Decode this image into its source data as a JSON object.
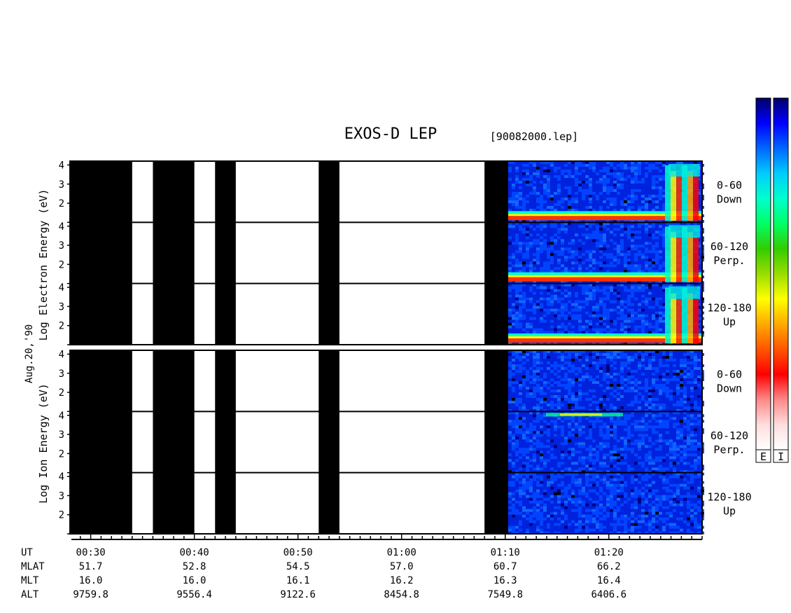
{
  "header": {
    "title": "EXOS-D LEP",
    "file_label": "[90082000.lep]"
  },
  "date_label": "Aug.20,'90",
  "panels": {
    "electron": {
      "ylabel": "Log Electron Energy (eV)",
      "yticks": [
        "4",
        "3",
        "2"
      ],
      "channels": [
        {
          "label_line1": "0-60",
          "label_line2": "Down"
        },
        {
          "label_line1": "60-120",
          "label_line2": "Perp."
        },
        {
          "label_line1": "120-180",
          "label_line2": "Up"
        }
      ]
    },
    "ion": {
      "ylabel": "Log Ion Energy (eV)",
      "yticks": [
        "4",
        "3",
        "2"
      ],
      "channels": [
        {
          "label_line1": "0-60",
          "label_line2": "Down"
        },
        {
          "label_line1": "60-120",
          "label_line2": "Perp."
        },
        {
          "label_line1": "120-180",
          "label_line2": "Up"
        }
      ]
    }
  },
  "colorbars": {
    "labels": [
      "E",
      "I"
    ],
    "colors_top_to_bottom": [
      "#000066",
      "#0000ff",
      "#0066ff",
      "#00ccff",
      "#00ffcc",
      "#00ff66",
      "#33cc00",
      "#99dd00",
      "#ffff00",
      "#ffaa00",
      "#ff5500",
      "#ff0000",
      "#ff8888",
      "#ffdddd",
      "#ffffff"
    ]
  },
  "chart_data": {
    "type": "heatmap",
    "title": "EXOS-D LEP",
    "xlabel": "UT",
    "ylabel": "Log Energy (eV)",
    "x_ticks": [
      "00:30",
      "00:40",
      "00:50",
      "01:00",
      "01:10",
      "01:20"
    ],
    "ylim": [
      1,
      4.2
    ],
    "data_gaps_ut": [
      [
        "00:28",
        "00:34"
      ],
      [
        "00:36",
        "00:40"
      ],
      [
        "00:42",
        "00:44"
      ],
      [
        "00:52",
        "00:54"
      ],
      [
        "01:08",
        "01:09"
      ]
    ],
    "ephemeris": {
      "rows": [
        {
          "name": "UT",
          "values": [
            "00:30",
            "00:40",
            "00:50",
            "01:00",
            "01:10",
            "01:20"
          ]
        },
        {
          "name": "MLAT",
          "values": [
            "51.7",
            "52.8",
            "54.5",
            "57.0",
            "60.7",
            "66.2"
          ]
        },
        {
          "name": "MLT",
          "values": [
            "16.0",
            "16.0",
            "16.1",
            "16.2",
            "16.3",
            "16.4"
          ]
        },
        {
          "name": "ALT",
          "values": [
            "9759.8",
            "9556.4",
            "9122.6",
            "8454.8",
            "7549.8",
            "6406.6"
          ]
        }
      ]
    }
  }
}
